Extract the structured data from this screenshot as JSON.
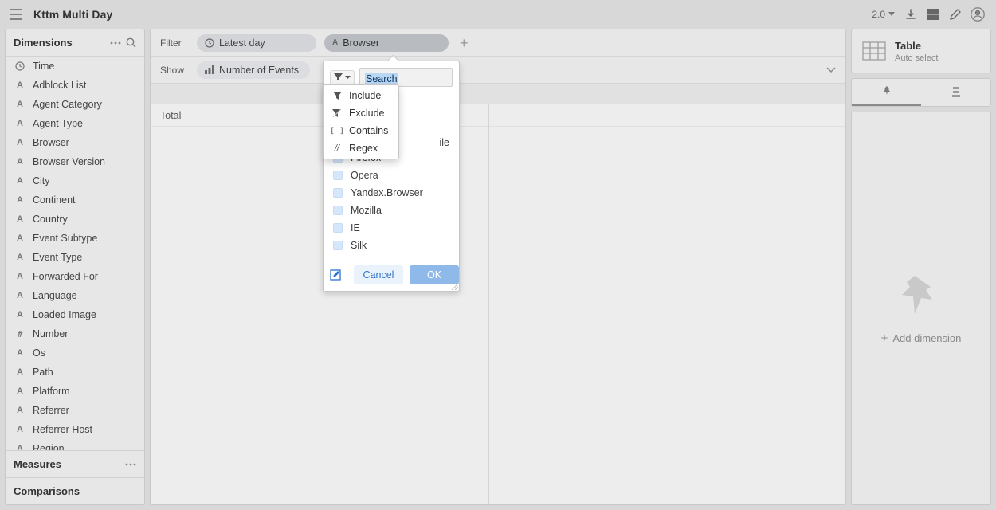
{
  "header": {
    "title": "Kttm Multi Day",
    "version": "2.0"
  },
  "sidebar": {
    "dimensions_label": "Dimensions",
    "measures_label": "Measures",
    "comparisons_label": "Comparisons",
    "items": [
      {
        "icon": "clock",
        "label": "Time"
      },
      {
        "icon": "A",
        "label": "Adblock List"
      },
      {
        "icon": "A",
        "label": "Agent Category"
      },
      {
        "icon": "A",
        "label": "Agent Type"
      },
      {
        "icon": "A",
        "label": "Browser"
      },
      {
        "icon": "A",
        "label": "Browser Version"
      },
      {
        "icon": "A",
        "label": "City"
      },
      {
        "icon": "A",
        "label": "Continent"
      },
      {
        "icon": "A",
        "label": "Country"
      },
      {
        "icon": "A",
        "label": "Event Subtype"
      },
      {
        "icon": "A",
        "label": "Event Type"
      },
      {
        "icon": "A",
        "label": "Forwarded For"
      },
      {
        "icon": "A",
        "label": "Language"
      },
      {
        "icon": "A",
        "label": "Loaded Image"
      },
      {
        "icon": "#",
        "label": "Number"
      },
      {
        "icon": "A",
        "label": "Os"
      },
      {
        "icon": "A",
        "label": "Path"
      },
      {
        "icon": "A",
        "label": "Platform"
      },
      {
        "icon": "A",
        "label": "Referrer"
      },
      {
        "icon": "A",
        "label": "Referrer Host"
      },
      {
        "icon": "A",
        "label": "Region"
      }
    ]
  },
  "filters": {
    "row_label": "Filter",
    "pills": [
      {
        "icon": "clock",
        "label": "Latest day"
      },
      {
        "icon": "A",
        "label": "Browser"
      }
    ]
  },
  "show": {
    "row_label": "Show",
    "pills": [
      {
        "icon": "bars",
        "label": "Number of Events"
      }
    ]
  },
  "grid": {
    "total_label": "Total"
  },
  "popup": {
    "search_text": "Search",
    "mode_menu": [
      "Include",
      "Exclude",
      "Contains",
      "Regex"
    ],
    "visible_values": [
      "ile",
      "Firefox",
      "Opera",
      "Yandex.Browser",
      "Mozilla",
      "IE",
      "Silk"
    ],
    "cancel": "Cancel",
    "ok": "OK"
  },
  "right": {
    "viz_title": "Table",
    "viz_sub": "Auto select",
    "add_dimension": "Add dimension"
  }
}
